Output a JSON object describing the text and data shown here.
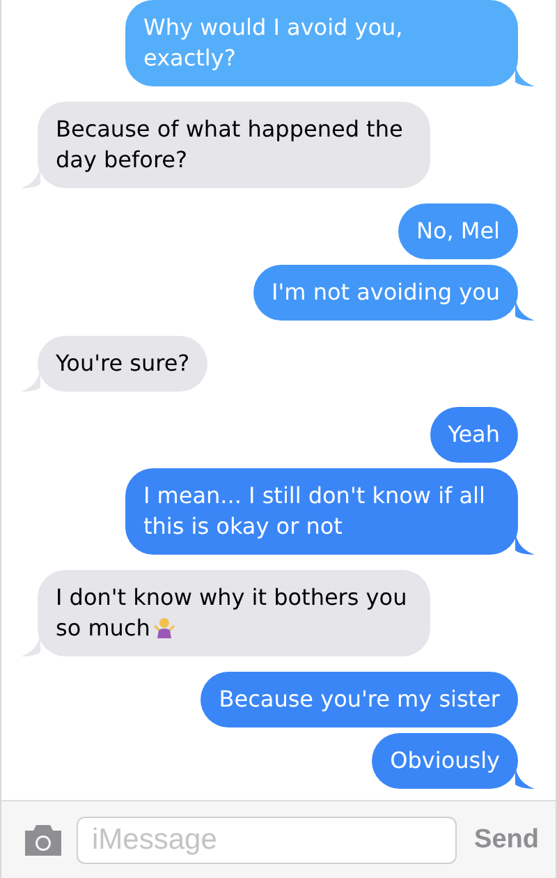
{
  "messages": [
    {
      "kind": "sent",
      "text": "Why would I avoid you, exactly?"
    },
    {
      "kind": "received",
      "text": "Because of what happened the day before?"
    },
    {
      "kind": "sent",
      "text": "No, Mel"
    },
    {
      "kind": "sent",
      "text": "I'm not avoiding you"
    },
    {
      "kind": "received",
      "text": "You're sure?"
    },
    {
      "kind": "sent",
      "text": "Yeah"
    },
    {
      "kind": "sent",
      "text": "I mean... I still don't know if all this is okay or not"
    },
    {
      "kind": "received",
      "text": "I don't know why it bothers you so much",
      "icon": true
    },
    {
      "kind": "sent",
      "text": "Because you're my sister"
    },
    {
      "kind": "sent",
      "text": "Obviously"
    }
  ],
  "composer": {
    "placeholder": "iMessage",
    "send": "Send"
  }
}
